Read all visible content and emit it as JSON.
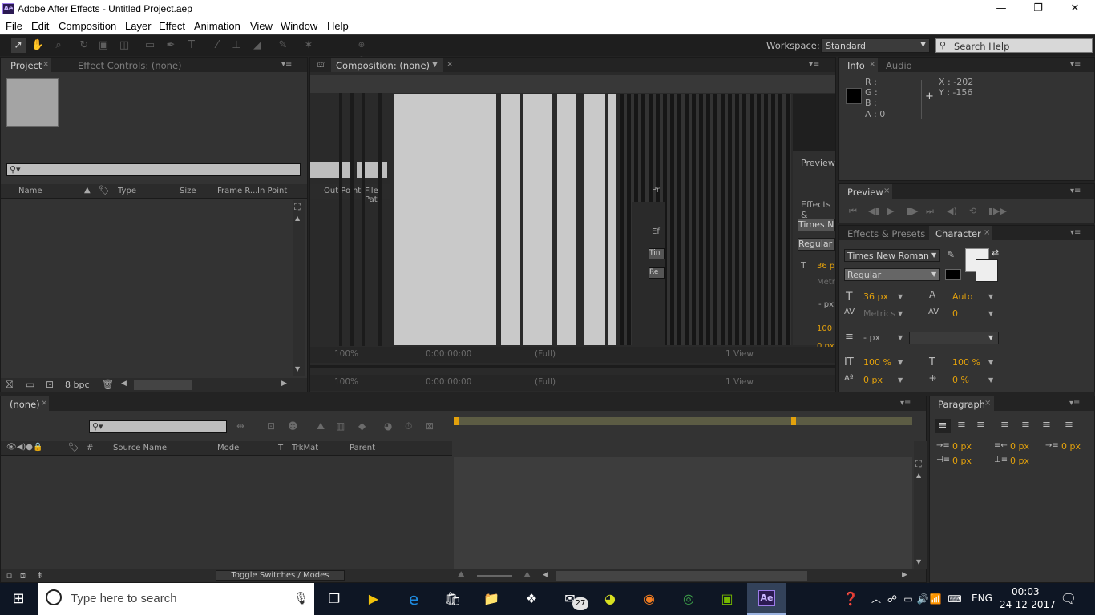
{
  "window": {
    "title": "Adobe After Effects - Untitled Project.aep",
    "logo": "Ae",
    "minimize": "—",
    "maximize": "❐",
    "close": "✕"
  },
  "menu": [
    "File",
    "Edit",
    "Composition",
    "Layer",
    "Effect",
    "Animation",
    "View",
    "Window",
    "Help"
  ],
  "toolbar": {
    "workspace_label": "Workspace:",
    "workspace_value": "Standard",
    "search_placeholder": "Search Help"
  },
  "project": {
    "tab": "Project",
    "tab2": "Effect Controls: (none)",
    "columns": [
      "Name",
      "Type",
      "Size",
      "Frame R...",
      "In Point"
    ],
    "bpc": "8 bpc"
  },
  "composition": {
    "tab": "Composition: (none)",
    "columns": [
      "Out Point",
      "File Pat"
    ],
    "zoom": "100%",
    "timecode": "0:00:00:00",
    "resolution": "(Full)",
    "views": "1 View",
    "ghost_labels": {
      "preview": "Preview",
      "effects": "Effects &",
      "font": "Times N",
      "style": "Regular",
      "size": "36 p",
      "metrics": "Metr",
      "px": "- px",
      "pct": "100",
      "zero": "0 px",
      "pr": "Pr",
      "ef": "Ef",
      "tin": "Tin",
      "re": "Re",
      "p": "P"
    }
  },
  "info": {
    "tab": "Info",
    "tab2": "Audio",
    "r": "R :",
    "g": "G :",
    "b": "B :",
    "a": "A : 0",
    "x": "X : -202",
    "y": "Y : -156",
    "swatch": "#000000"
  },
  "preview": {
    "tab": "Preview"
  },
  "character": {
    "tab1": "Effects & Presets",
    "tab2": "Character",
    "font": "Times New Roman",
    "style": "Regular",
    "size": "36 px",
    "leading": "Auto",
    "kerning": "Metrics",
    "tracking": "0",
    "stroke": "- px",
    "vscale": "100 %",
    "hscale": "100 %",
    "baseline": "0 px",
    "tsume": "0 %"
  },
  "timeline": {
    "tab": "(none)",
    "columns": [
      "#",
      "Source Name",
      "Mode",
      "T",
      "TrkMat",
      "Parent"
    ],
    "toggle": "Toggle Switches / Modes"
  },
  "paragraph": {
    "tab": "Paragraph",
    "indent_left": "0 px",
    "indent_right": "0 px",
    "indent_first": "0 px",
    "space_before": "0 px",
    "space_after": "0 px"
  },
  "taskbar": {
    "search_placeholder": "Type here to search",
    "mail_badge": "27",
    "lang": "ENG",
    "time": "00:03",
    "date": "24-12-2017"
  }
}
